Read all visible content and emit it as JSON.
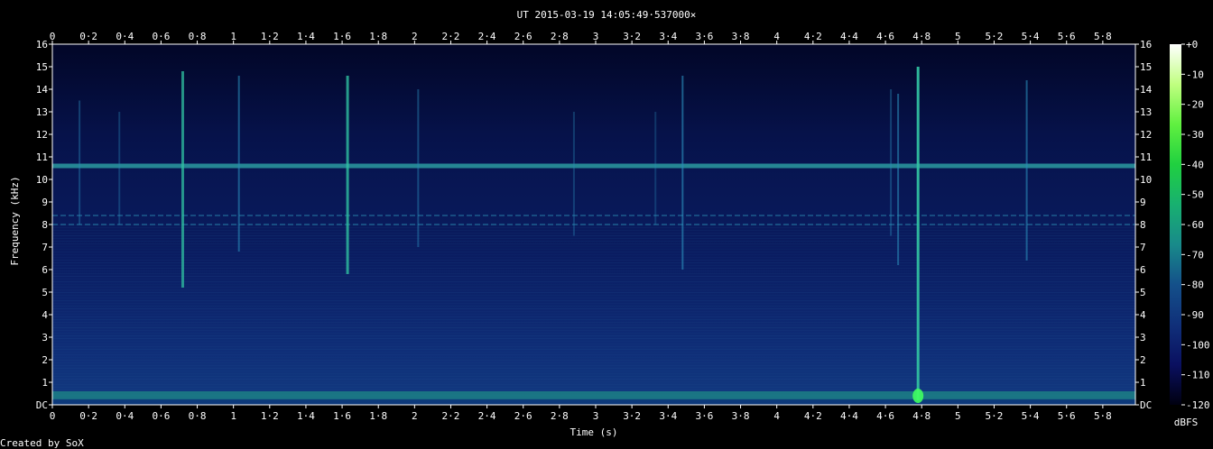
{
  "chart_data": {
    "type": "heatmap",
    "title": "UT 2015-03-19 14:05:49·537000×",
    "xlabel": "Time (s)",
    "ylabel": "Frequency (kHz)",
    "xlim": [
      0,
      5.98
    ],
    "ylim": [
      0,
      16
    ],
    "x_ticks": [
      "0",
      "0·2",
      "0·4",
      "0·6",
      "0·8",
      "1",
      "1·2",
      "1·4",
      "1·6",
      "1·8",
      "2",
      "2·2",
      "2·4",
      "2·6",
      "2·8",
      "3",
      "3·2",
      "3·4",
      "3·6",
      "3·8",
      "4",
      "4·2",
      "4·4",
      "4·6",
      "4·8",
      "5",
      "5·2",
      "5·4",
      "5·6",
      "5·8"
    ],
    "y_ticks": [
      "DC",
      "1",
      "2",
      "3",
      "4",
      "5",
      "6",
      "7",
      "8",
      "9",
      "10",
      "11",
      "12",
      "13",
      "14",
      "15",
      "16"
    ],
    "colorbar": {
      "label": "dBFS",
      "ticks": [
        "+0",
        "-10",
        "-20",
        "-30",
        "-40",
        "-50",
        "-60",
        "-70",
        "-80",
        "-90",
        "-100",
        "-110",
        "-120"
      ],
      "range": [
        -120,
        0
      ],
      "colors": [
        "#000010",
        "#0a1060",
        "#10307a",
        "#14508a",
        "#188a8a",
        "#18b070",
        "#20d040",
        "#60f040",
        "#c0ff80",
        "#ffffff"
      ]
    },
    "features": {
      "background_band_khz": [
        0.2,
        0.6
      ],
      "horizontal_tone_khz": 10.6,
      "horizontal_tones_faint_khz": [
        8.0,
        8.4
      ],
      "impulses": [
        {
          "t": 0.72,
          "fmin": 5.2,
          "fmax": 14.8,
          "strength": 0.75
        },
        {
          "t": 1.03,
          "fmin": 6.8,
          "fmax": 14.6,
          "strength": 0.6
        },
        {
          "t": 1.63,
          "fmin": 5.8,
          "fmax": 14.6,
          "strength": 0.8
        },
        {
          "t": 2.02,
          "fmin": 7.0,
          "fmax": 14.0,
          "strength": 0.45
        },
        {
          "t": 0.15,
          "fmin": 8.0,
          "fmax": 13.5,
          "strength": 0.4
        },
        {
          "t": 0.37,
          "fmin": 8.0,
          "fmax": 13.0,
          "strength": 0.35
        },
        {
          "t": 3.48,
          "fmin": 6.0,
          "fmax": 14.6,
          "strength": 0.65
        },
        {
          "t": 4.67,
          "fmin": 6.2,
          "fmax": 13.8,
          "strength": 0.6
        },
        {
          "t": 4.78,
          "fmin": 0.2,
          "fmax": 15.0,
          "strength": 0.95
        },
        {
          "t": 5.38,
          "fmin": 6.4,
          "fmax": 14.4,
          "strength": 0.6
        },
        {
          "t": 4.63,
          "fmin": 7.5,
          "fmax": 14.0,
          "strength": 0.4
        },
        {
          "t": 2.88,
          "fmin": 7.5,
          "fmax": 13.0,
          "strength": 0.35
        },
        {
          "t": 3.33,
          "fmin": 8.0,
          "fmax": 13.0,
          "strength": 0.3
        }
      ],
      "hotspot": {
        "t": 4.78,
        "f": 0.4
      }
    }
  },
  "footer": {
    "credit": "Created by SoX"
  }
}
